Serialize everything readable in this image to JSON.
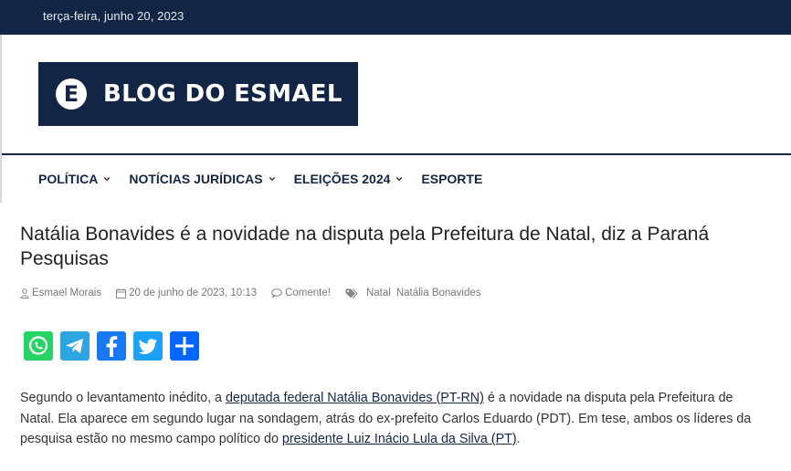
{
  "topbar": {
    "date": "terça-feira, junho 20, 2023"
  },
  "logo": {
    "badge_letter": "E",
    "text": "BLOG DO ESMAEL"
  },
  "nav": [
    {
      "label": "POLÍTICA",
      "has_dropdown": true
    },
    {
      "label": "NOTÍCIAS JURÍDICAS",
      "has_dropdown": true
    },
    {
      "label": "ELEIÇÕES 2024",
      "has_dropdown": true
    },
    {
      "label": "ESPORTE",
      "has_dropdown": false
    }
  ],
  "article": {
    "title": "Natália Bonavides é a novidade na disputa pela Prefeitura de Natal, diz a Paraná Pesquisas",
    "author": "Esmael Morais",
    "date": "20 de junho de 2023, 10:13",
    "comments": "Comente!",
    "tags": [
      "Natal",
      "Natália Bonavides"
    ],
    "body": {
      "p1_before": "Segundo o levantamento inédito, a ",
      "p1_link1": "deputada federal Natália Bonavides (PT-RN)",
      "p1_mid": " é a novidade na disputa pela Prefeitura de Natal. Ela aparece em segundo lugar na sondagem, atrás do ex-prefeito Carlos Eduardo (PDT). Em tese, ambos os líderes da pesquisa estão no mesmo campo político do ",
      "p1_link2": "presidente Luiz Inácio Lula da Silva (PT)",
      "p1_after": "."
    }
  },
  "share": [
    {
      "icon": "whatsapp-icon",
      "color": "#25D366"
    },
    {
      "icon": "telegram-icon",
      "color": "#2CA5E0"
    },
    {
      "icon": "facebook-icon",
      "color": "#1877F2"
    },
    {
      "icon": "twitter-icon",
      "color": "#1DA1F2"
    },
    {
      "icon": "share-icon",
      "color": "#0066FF"
    }
  ],
  "colors": {
    "brand_navy": "#122544"
  }
}
